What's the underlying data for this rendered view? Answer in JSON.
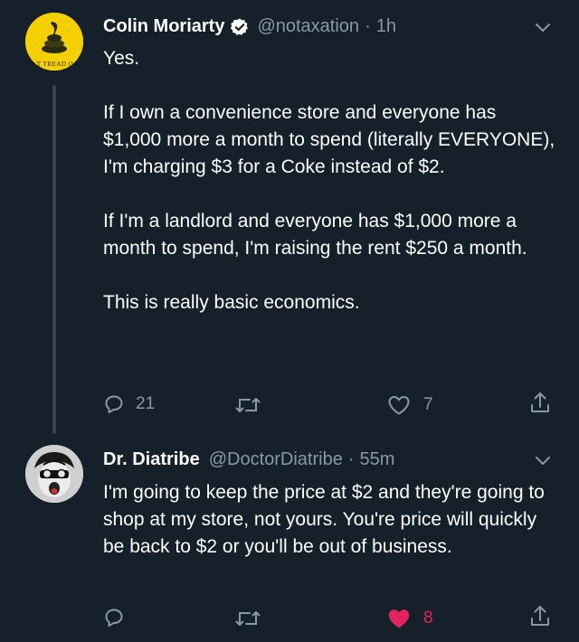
{
  "tweet1": {
    "name": "Colin Moriarty",
    "handle": "@notaxation",
    "time": "1h",
    "avatar_text": "T TREAD O",
    "text": "Yes.\n\nIf I own a convenience store and everyone has $1,000 more a month to spend (literally EVERYONE), I'm charging $3 for a Coke instead of $2.\n\nIf I'm a landlord and everyone has $1,000 more a month to spend, I'm raising the rent $250 a month.\n\nThis is really basic economics.",
    "replies": "21",
    "likes": "7"
  },
  "tweet2": {
    "name": "Dr. Diatribe",
    "handle": "@DoctorDiatribe",
    "time": "55m",
    "text": "I'm going to keep the price at $2 and they're going to shop at my store, not yours. You're price will quickly be back to $2 or you'll be out of business.",
    "likes": "8"
  },
  "separator": "·",
  "icons": {
    "verified": "verified-badge-icon",
    "reply": "reply-icon",
    "retweet": "retweet-icon",
    "like": "heart-icon",
    "share": "share-icon",
    "more": "chevron-down-icon"
  },
  "colors": {
    "background": "#15202b",
    "text": "#ffffff",
    "secondary": "#8899a6",
    "verified": "#ffffff",
    "liked": "#e0245e",
    "avatar_yellow": "#f5d000"
  }
}
